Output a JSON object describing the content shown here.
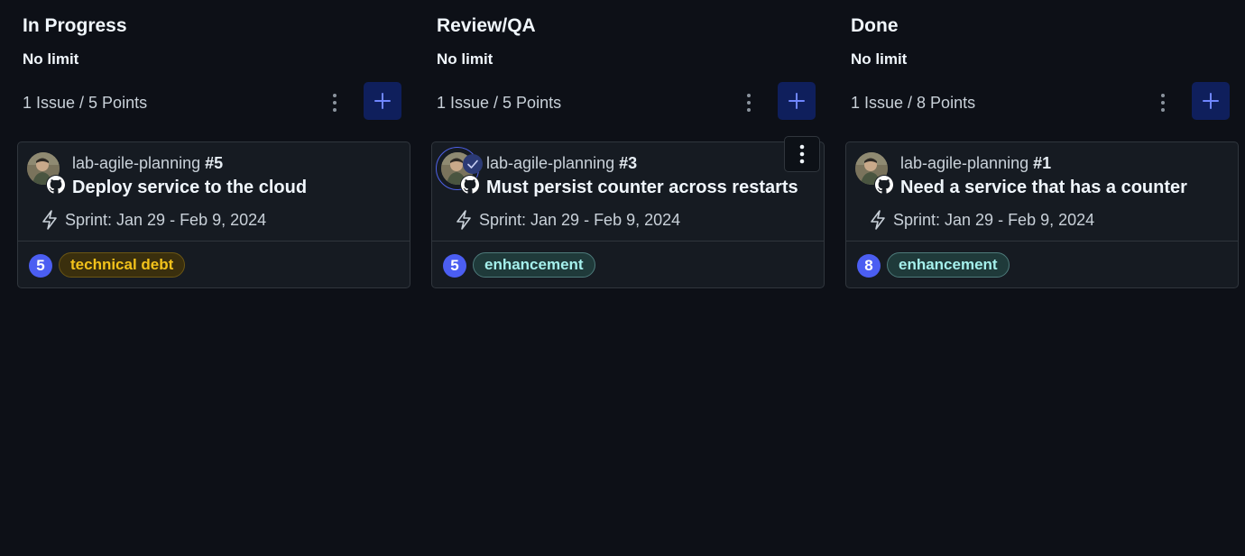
{
  "columns": [
    {
      "title": "In Progress",
      "limit": "No limit",
      "count": "1 Issue / 5 Points",
      "card": {
        "repo": "lab-agile-planning",
        "number": "#5",
        "title": "Deploy service to the cloud",
        "sprint": "Sprint: Jan 29 - Feb 9, 2024",
        "points": "5",
        "label": "technical debt",
        "label_color": "#f2c21b"
      }
    },
    {
      "title": "Review/QA",
      "limit": "No limit",
      "count": "1 Issue / 5 Points",
      "card": {
        "repo": "lab-agile-planning",
        "number": "#3",
        "title": "Must persist counter across restarts",
        "sprint": "Sprint: Jan 29 - Feb 9, 2024",
        "points": "5",
        "label": "enhancement",
        "label_color": "#a5f0ec"
      }
    },
    {
      "title": "Done",
      "limit": "No limit",
      "count": "1 Issue / 8 Points",
      "card": {
        "repo": "lab-agile-planning",
        "number": "#1",
        "title": "Need a service that has a counter",
        "sprint": "Sprint: Jan 29 - Feb 9, 2024",
        "points": "8",
        "label": "enhancement",
        "label_color": "#a5f0ec"
      }
    }
  ],
  "icons": {
    "column_menu": "kebab-icon",
    "add": "plus-icon",
    "sprint": "lightning-icon",
    "repo_source": "github-icon",
    "selected": "check-icon",
    "card_menu": "kebab-icon"
  },
  "colors": {
    "background": "#0d1017",
    "card": "#161b22",
    "accent": "#4b5ef2",
    "add_button": "#0f1f5c"
  }
}
